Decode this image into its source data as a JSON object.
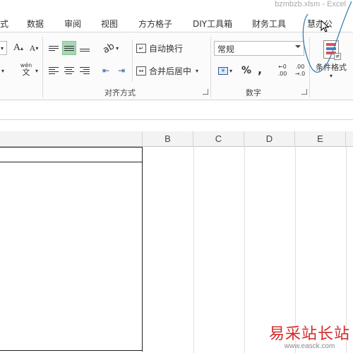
{
  "window": {
    "title": "bzmbzb.xlsm - Excel"
  },
  "tabs": [
    {
      "label": "式"
    },
    {
      "label": "数据"
    },
    {
      "label": "审阅"
    },
    {
      "label": "视图"
    },
    {
      "label": "方方格子"
    },
    {
      "label": "DIY工具箱"
    },
    {
      "label": "财务工具"
    },
    {
      "label": "慧办公"
    }
  ],
  "ribbon": {
    "font": {
      "grow_label": "A",
      "shrink_label": "A",
      "phonetic_label": "wén",
      "phonetic_char": "文"
    },
    "alignment": {
      "wrap_text_label": "自动换行",
      "merge_center_label": "合并后居中",
      "group_label": "对齐方式"
    },
    "number": {
      "format_value": "常规",
      "percent_label": "%",
      "comma_label": ",",
      "inc_decimal_top": "←0",
      "inc_decimal_bottom": ".00",
      "dec_decimal_top": ".00",
      "dec_decimal_bottom": "→.0",
      "group_label": "数字"
    },
    "styles": {
      "conditional_format_label": "条件格式"
    }
  },
  "grid": {
    "columns": [
      "B",
      "C",
      "D",
      "E"
    ]
  },
  "watermark": {
    "text": "易采站长站",
    "url": "www.easck.com"
  },
  "colors": {
    "accent_selected": "#a6d8b4",
    "watermark_red": "#d32a2a"
  }
}
